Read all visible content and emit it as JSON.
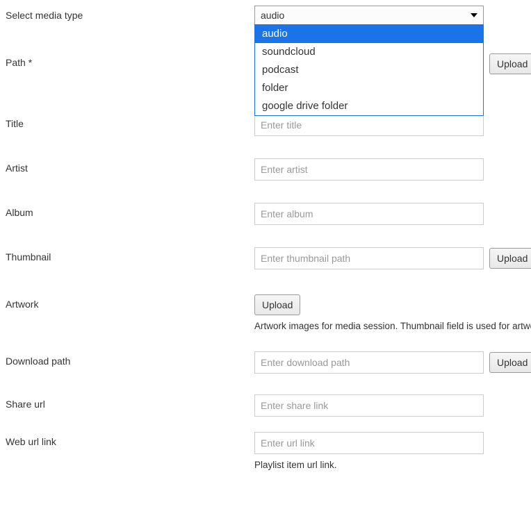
{
  "labels": {
    "media_type": "Select media type",
    "path": "Path *",
    "title": "Title",
    "artist": "Artist",
    "album": "Album",
    "thumbnail": "Thumbnail",
    "artwork": "Artwork",
    "download_path": "Download path",
    "share_url": "Share url",
    "web_url_link": "Web url link"
  },
  "media_type": {
    "selected": "audio",
    "options": [
      "audio",
      "soundcloud",
      "podcast",
      "folder",
      "google drive folder"
    ],
    "highlighted_index": 0
  },
  "placeholders": {
    "title": "Enter title",
    "artist": "Enter artist",
    "album": "Enter album",
    "thumbnail": "Enter thumbnail path",
    "download_path": "Enter download path",
    "share_url": "Enter share link",
    "web_url_link": "Enter url link"
  },
  "buttons": {
    "upload": "Upload"
  },
  "help": {
    "artwork": "Artwork images for media session. Thumbnail field is used for artwork by default, but its recommended to provide separate images in multiple sizes.",
    "web_url_link": "Playlist item url link."
  }
}
